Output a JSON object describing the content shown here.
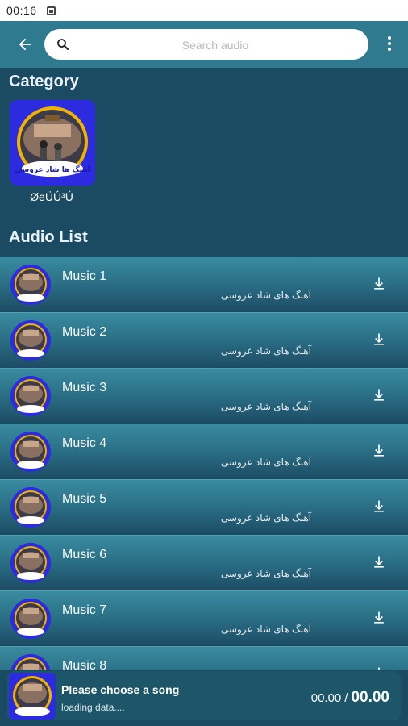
{
  "status_bar": {
    "time": "00:16"
  },
  "toolbar": {
    "search_placeholder": "Search audio"
  },
  "category": {
    "section_title": "Category",
    "items": [
      {
        "label": "ØeÜÚ³Ú",
        "art_text": "آهنگ ها شاد عروسی"
      }
    ]
  },
  "audio_list": {
    "section_title": "Audio List",
    "items": [
      {
        "title": "Music 1",
        "subtitle": "آهنگ های شاد عروسی"
      },
      {
        "title": "Music 2",
        "subtitle": "آهنگ های شاد عروسی"
      },
      {
        "title": "Music 3",
        "subtitle": "آهنگ های شاد عروسی"
      },
      {
        "title": "Music 4",
        "subtitle": "آهنگ های شاد عروسی"
      },
      {
        "title": "Music 5",
        "subtitle": "آهنگ های شاد عروسی"
      },
      {
        "title": "Music 6",
        "subtitle": "آهنگ های شاد عروسی"
      },
      {
        "title": "Music 7",
        "subtitle": "آهنگ های شاد عروسی"
      },
      {
        "title": "Music 8",
        "subtitle": ""
      }
    ]
  },
  "player": {
    "title": "Please choose a song",
    "subtitle": "loading data....",
    "current_time": "00.00",
    "separator": "/",
    "duration": "00.00"
  },
  "icons": {
    "back": "arrow-left-icon",
    "search": "magnifier-icon",
    "menu": "more-vertical-icon",
    "download": "download-icon"
  },
  "colors": {
    "toolbar": "#2f7a8f",
    "background": "#1b4a63",
    "row_gradient_top": "#3a8ba0",
    "row_gradient_bottom": "#1d4e66",
    "player": "#1d5569"
  }
}
